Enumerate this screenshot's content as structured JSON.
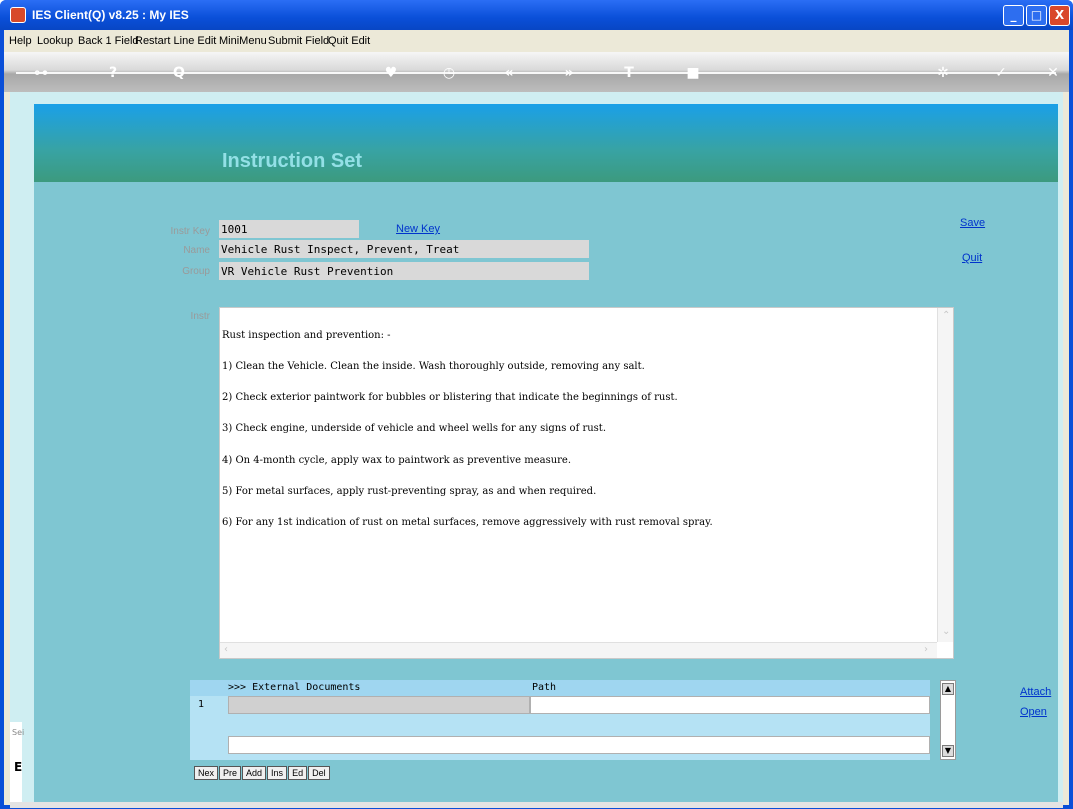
{
  "window": {
    "title": "IES Client(Q) v8.25 : My IES",
    "controls": {
      "minimize": "_",
      "maximize": "□",
      "close": "X"
    }
  },
  "menu": [
    "Help",
    "Lookup",
    "Back 1 Field",
    "Restart Line Edit",
    "MiniMenu",
    "Submit Field",
    "Quit Edit"
  ],
  "toolbar": {
    "icons": [
      "back-key-icon",
      "help-icon",
      "search-icon",
      "heart-icon",
      "clock-icon",
      "rewind-icon",
      "forward-icon",
      "edit-icon",
      "stop-icon",
      "settings-icon",
      "check-icon",
      "close-icon"
    ],
    "glyphs": {
      "back": "⊶",
      "help": "?",
      "search": "Q",
      "heart": "♥",
      "clock": "◷",
      "rewind": "«",
      "forward": "»",
      "edit": "T",
      "stop": "■",
      "settings": "✲",
      "check": "✓",
      "close": "✕"
    }
  },
  "header": {
    "title": "Instruction Set"
  },
  "form": {
    "instr_key_label": "Instr Key",
    "instr_key_value": "1001",
    "new_key_label": "New Key",
    "name_label": "Name",
    "name_value": "Vehicle Rust Inspect, Prevent, Treat",
    "group_label": "Group",
    "group_value": "VR Vehicle Rust Prevention",
    "instr_label": "Instr",
    "save_label": "Save",
    "quit_label": "Quit"
  },
  "instruction_text": [
    "Rust inspection and prevention: -",
    "1) Clean the Vehicle. Clean the inside. Wash thoroughly outside, removing any salt.",
    "2) Check exterior paintwork for bubbles or blistering that indicate the beginnings of rust.",
    "3) Check engine, underside of vehicle and wheel wells for any signs of rust.",
    "4) On 4-month cycle, apply wax to paintwork as preventive measure.",
    "5) For metal surfaces, apply rust-preventing spray, as and when required.",
    "6) For any 1st indication of rust on metal surfaces, remove aggressively with rust removal spray."
  ],
  "docs": {
    "col1": ">>> External Documents",
    "col2": "Path",
    "row_number": "1",
    "attach_label": "Attach",
    "open_label": "Open"
  },
  "nav_buttons": [
    "Nex",
    "Pre",
    "Add",
    "Ins",
    "Ed",
    "Del"
  ],
  "side": {
    "text1": "Sei",
    "text2": "E"
  }
}
